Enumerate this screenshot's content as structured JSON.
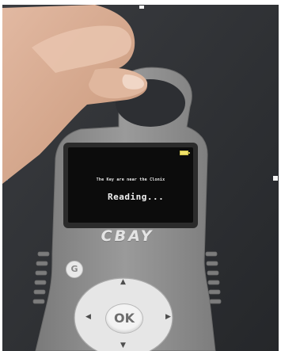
{
  "device": {
    "screen_message": "The Key are near the Clonix",
    "screen_status": "Reading...",
    "brand": "CBAY",
    "g_button_label": "G",
    "ok_button_label": "OK",
    "arrow_up": "▲",
    "arrow_down": "▼",
    "arrow_left": "◀",
    "arrow_right": "▶"
  },
  "colors": {
    "device_body": "#8f8f8f",
    "screen": "#0c0c0c",
    "background": "#2e3034",
    "battery": "#f2e36a"
  }
}
